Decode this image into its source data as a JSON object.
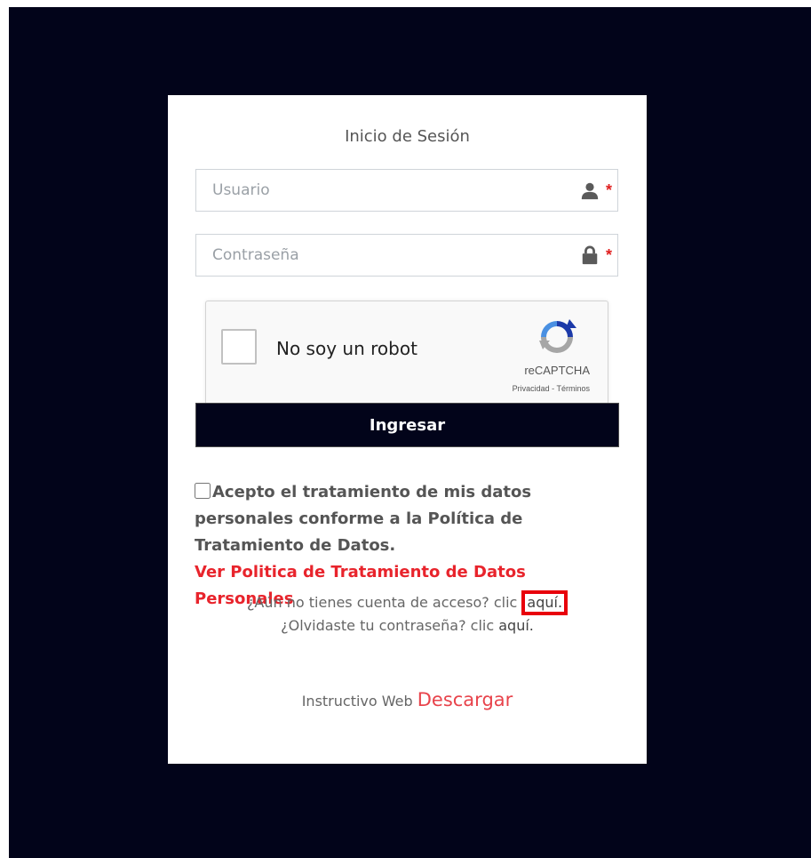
{
  "login": {
    "title": "Inicio de Sesión",
    "username_placeholder": "Usuario",
    "password_placeholder": "Contraseña",
    "user_icon": "user-icon",
    "lock_icon": "lock-icon",
    "required_mark": "*",
    "submit_label": "Ingresar"
  },
  "recaptcha": {
    "label": "No soy un robot",
    "brand": "reCAPTCHA",
    "links": "Privacidad - Términos"
  },
  "consent": {
    "text": "Acepto el tratamiento de mis datos personales conforme a la Política de Tratamiento de Datos.",
    "link": "Ver Politica de Tratamiento de Datos Personales"
  },
  "account": {
    "no_account_text": "¿Aún no tienes cuenta de acceso? clic",
    "no_account_link": "aquí.",
    "forgot_text": "¿Olvidaste tu contraseña? clic",
    "forgot_link": "aquí."
  },
  "footer": {
    "instructivo_text": "Instructivo Web",
    "download_link": "Descargar"
  },
  "colors": {
    "background": "#02041a",
    "accent_red": "#e8242c",
    "highlight_box": "#e8000b"
  }
}
